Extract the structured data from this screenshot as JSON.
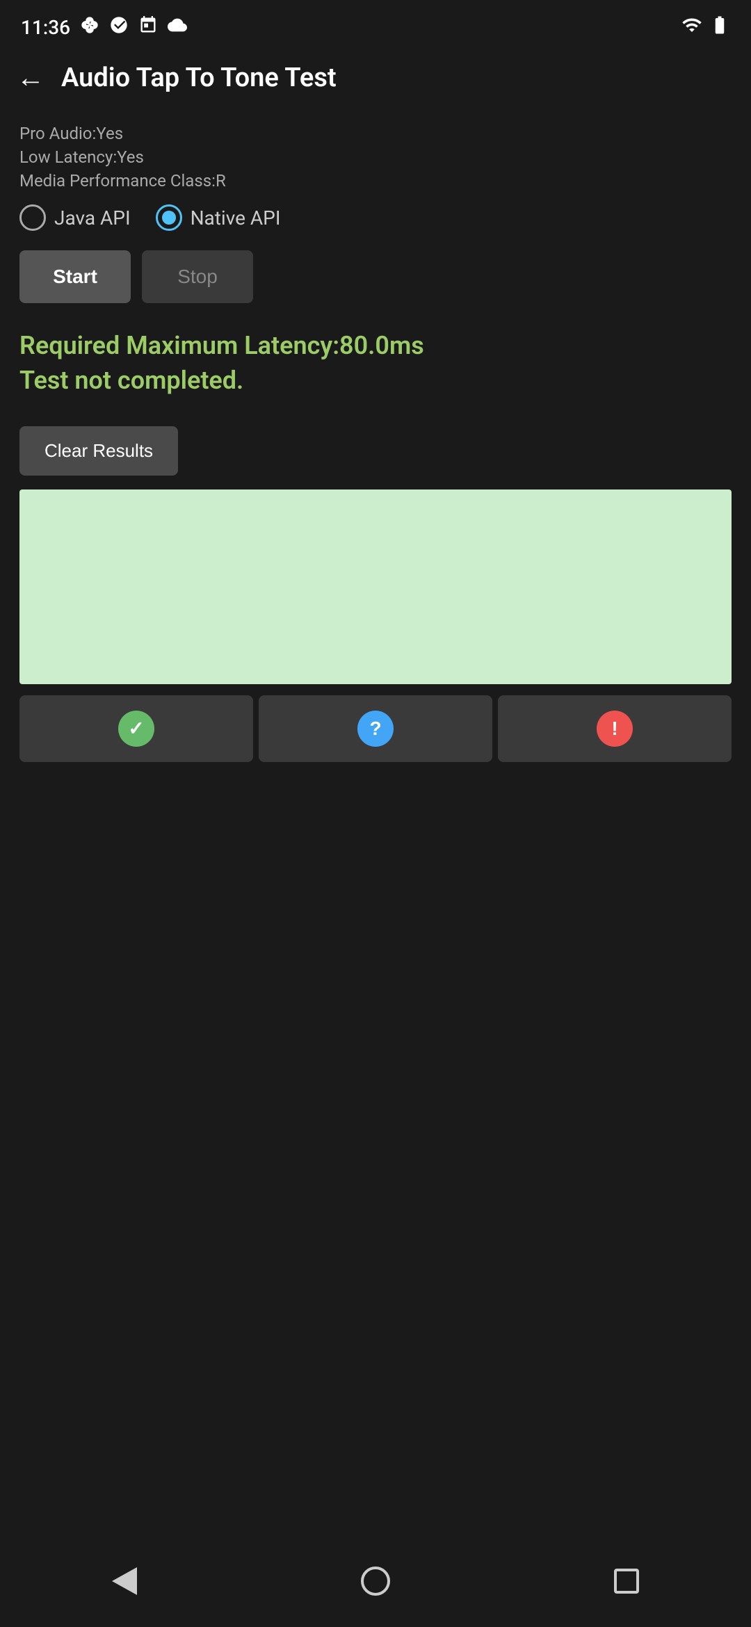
{
  "statusBar": {
    "time": "11:36",
    "icons": [
      "fan",
      "google",
      "calendar",
      "cloud"
    ]
  },
  "appBar": {
    "title": "Audio Tap To Tone Test",
    "backLabel": "←"
  },
  "deviceInfo": {
    "proAudio": "Pro Audio:Yes",
    "lowLatency": "Low Latency:Yes",
    "mediaPerformanceClass": "Media Performance Class:R"
  },
  "radioGroup": {
    "options": [
      {
        "id": "java",
        "label": "Java API",
        "selected": false
      },
      {
        "id": "native",
        "label": "Native API",
        "selected": true
      }
    ]
  },
  "buttons": {
    "start": "Start",
    "stop": "Stop",
    "clearResults": "Clear Results"
  },
  "results": {
    "line1": "Required Maximum Latency:80.0ms",
    "line2": "Test not completed."
  },
  "statusIcons": {
    "check": "✓",
    "question": "?",
    "exclamation": "!"
  },
  "navBar": {
    "back": "◀",
    "home": "⬤",
    "recent": "■"
  }
}
